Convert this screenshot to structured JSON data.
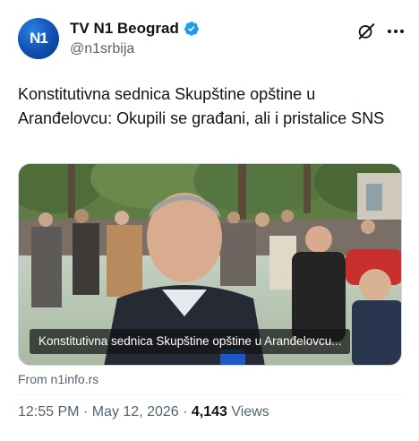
{
  "account": {
    "display_name": "TV N1 Beograd",
    "handle": "@n1srbija",
    "avatar_text": "N1",
    "verified_color": "#1d9bf0"
  },
  "tweet": {
    "text": "Konstitutivna sednica Skupštine opštine u Aranđelovcu: Okupili se građani, ali i pristalice SNS"
  },
  "media": {
    "caption": "Konstitutivna sednica Skupštine opštine u Aranđelovcu..."
  },
  "link_source": "From n1info.rs",
  "meta": {
    "time": "12:55 PM",
    "separator_1": "·",
    "date": "May 12, 2026",
    "separator_2": "·",
    "views_count": "4,143",
    "views_label": "Views"
  },
  "icons": {
    "grok": "grok-icon",
    "more": "more-icon",
    "verified": "verified-badge-icon"
  },
  "colors": {
    "text_primary": "#0f1419",
    "text_secondary": "#536471",
    "brand_blue": "#1d9bf0"
  }
}
